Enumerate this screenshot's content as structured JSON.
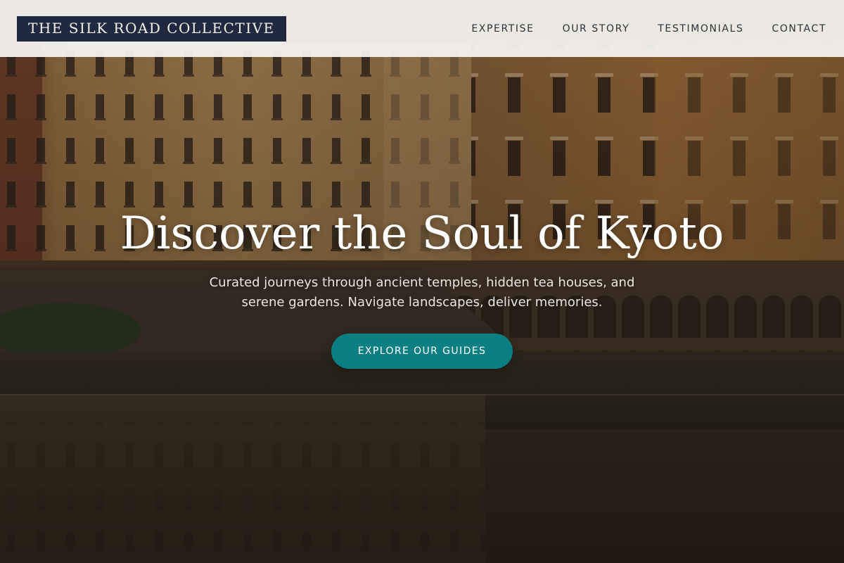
{
  "brand": {
    "logo_text": "THE SILK ROAD COLLECTIVE"
  },
  "nav": {
    "items": [
      {
        "label": "EXPERTISE"
      },
      {
        "label": "OUR STORY"
      },
      {
        "label": "TESTIMONIALS"
      },
      {
        "label": "CONTACT"
      }
    ]
  },
  "hero": {
    "title": "Discover the Soul of Kyoto",
    "subtitle": "Curated journeys through ancient temples, hidden tea houses, and serene gardens. Navigate landscapes, deliver memories.",
    "cta_label": "EXPLORE OUR GUIDES"
  },
  "colors": {
    "header_bg": "#f4f2ef",
    "logo_bg": "#1f2a40",
    "cta_bg": "#0c7f82",
    "nav_text": "#2d3138"
  },
  "background_image": {
    "icon_name": "riverside-buildings-photo"
  }
}
